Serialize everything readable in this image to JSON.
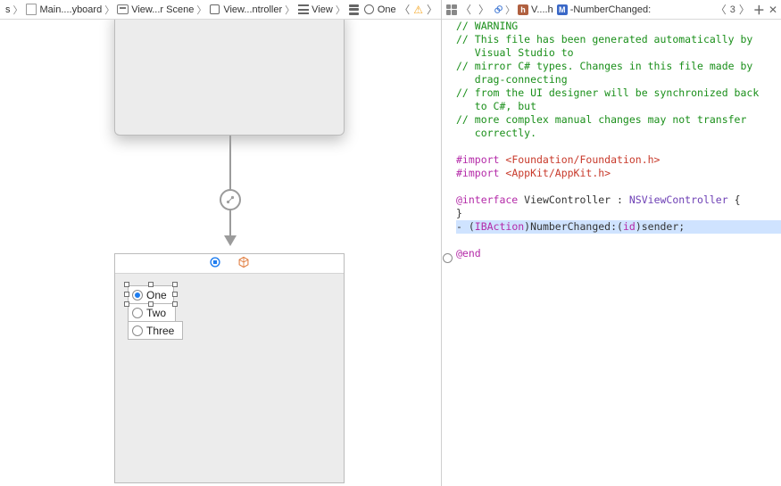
{
  "left_breadcrumb": {
    "root_indicator": "s",
    "items": [
      {
        "label": "Main....yboard"
      },
      {
        "label": "View...r Scene"
      },
      {
        "label": "View...ntroller"
      },
      {
        "label": "View"
      },
      {
        "label": "One"
      }
    ]
  },
  "right_breadcrumb": {
    "file_label": "V....h",
    "method_label": "-NumberChanged:",
    "counter": "3"
  },
  "radios": {
    "items": [
      "One",
      "Two",
      "Three"
    ],
    "selected_index": 0
  },
  "code": {
    "comments": [
      "// WARNING",
      "// This file has been generated automatically by",
      "   Visual Studio to",
      "// mirror C# types. Changes in this file made by",
      "   drag-connecting",
      "// from the UI designer will be synchronized back",
      "   to C#, but",
      "// more complex manual changes may not transfer",
      "   correctly."
    ],
    "import1_a": "#import ",
    "import1_b": "<Foundation/Foundation.h>",
    "import2_a": "#import ",
    "import2_b": "<AppKit/AppKit.h>",
    "iface_kw": "@interface",
    "iface_name": " ViewController : ",
    "iface_super": "NSViewController",
    "iface_tail": " {",
    "brace_close": "}",
    "action_dash": "- (",
    "action_ib": "IBAction",
    "action_mid": ")NumberChanged:(",
    "action_id": "id",
    "action_end": ")sender;",
    "end_kw": "@end"
  }
}
